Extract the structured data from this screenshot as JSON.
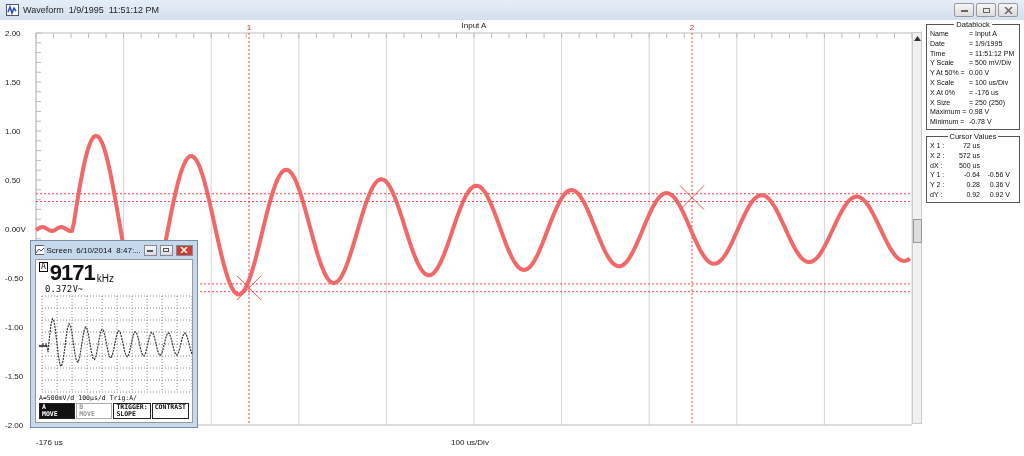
{
  "window": {
    "title": "Waveform  1/9/1995  11:51:12 PM"
  },
  "plot": {
    "title": "Input A",
    "y_labels": [
      "2.00",
      "1.50",
      "1.00",
      "0.50",
      "0.00V",
      "-0.50",
      "-1.00",
      "-1.50",
      "-2.00"
    ],
    "x_start": "-176 us",
    "x_scale": "100 us/Div",
    "cursors": [
      {
        "label": "1"
      },
      {
        "label": "2"
      }
    ]
  },
  "datablock": {
    "title": "Datablock",
    "rows": [
      {
        "label": "Name",
        "value": "= Input A",
        "unit": ""
      },
      {
        "label": "Date",
        "value": "= 1/9/1995",
        "unit": ""
      },
      {
        "label": "Time",
        "value": "= 11:51:12 PM",
        "unit": ""
      },
      {
        "label": "Y Scale",
        "value": "=  500",
        "unit": "mV/Div"
      },
      {
        "label": "Y At 50% =",
        "value": "0.00 V",
        "unit": ""
      },
      {
        "label": "X Scale",
        "value": "=  100",
        "unit": "us/Div"
      },
      {
        "label": "X At 0%",
        "value": "= -176",
        "unit": "us"
      },
      {
        "label": "X Size",
        "value": "= 250 (250)",
        "unit": ""
      },
      {
        "label": "Maximum =",
        "value": "0.98 V",
        "unit": ""
      },
      {
        "label": "Minimum =",
        "value": "-0.78 V",
        "unit": ""
      }
    ]
  },
  "cursor_values": {
    "title": "Cursor Values",
    "rows": [
      {
        "label": "X 1 :",
        "values": [
          "72 us"
        ]
      },
      {
        "label": "X 2 :",
        "values": [
          "572 us"
        ]
      },
      {
        "label": "dX :",
        "values": [
          "500 us"
        ]
      },
      {
        "label": "Y 1 :",
        "values": [
          "-0.64",
          "-0.56 V"
        ]
      },
      {
        "label": "Y 2 :",
        "values": [
          "0.28",
          "0.36 V"
        ]
      },
      {
        "label": "dY :",
        "values": [
          "0.92",
          "0.92 V"
        ]
      }
    ]
  },
  "screen_window": {
    "title": "Screen  6/10/2014  8:47:...",
    "channel": "A",
    "frequency": "9171",
    "frequency_unit": "kHz",
    "amplitude": "0.372",
    "amplitude_unit": "V~",
    "status": [
      "A=500mV/d",
      "100µs/d",
      "Trig:A/"
    ],
    "buttons": [
      {
        "lines": [
          "A",
          "MOVE"
        ],
        "selected": true,
        "disabled": false
      },
      {
        "lines": [
          "B",
          "MOVE"
        ],
        "selected": false,
        "disabled": true
      },
      {
        "lines": [
          "TRIGGER:",
          "SLOPE"
        ],
        "selected": false,
        "disabled": false
      },
      {
        "lines": [
          "CONTRAST"
        ],
        "selected": false,
        "disabled": false
      }
    ]
  }
}
